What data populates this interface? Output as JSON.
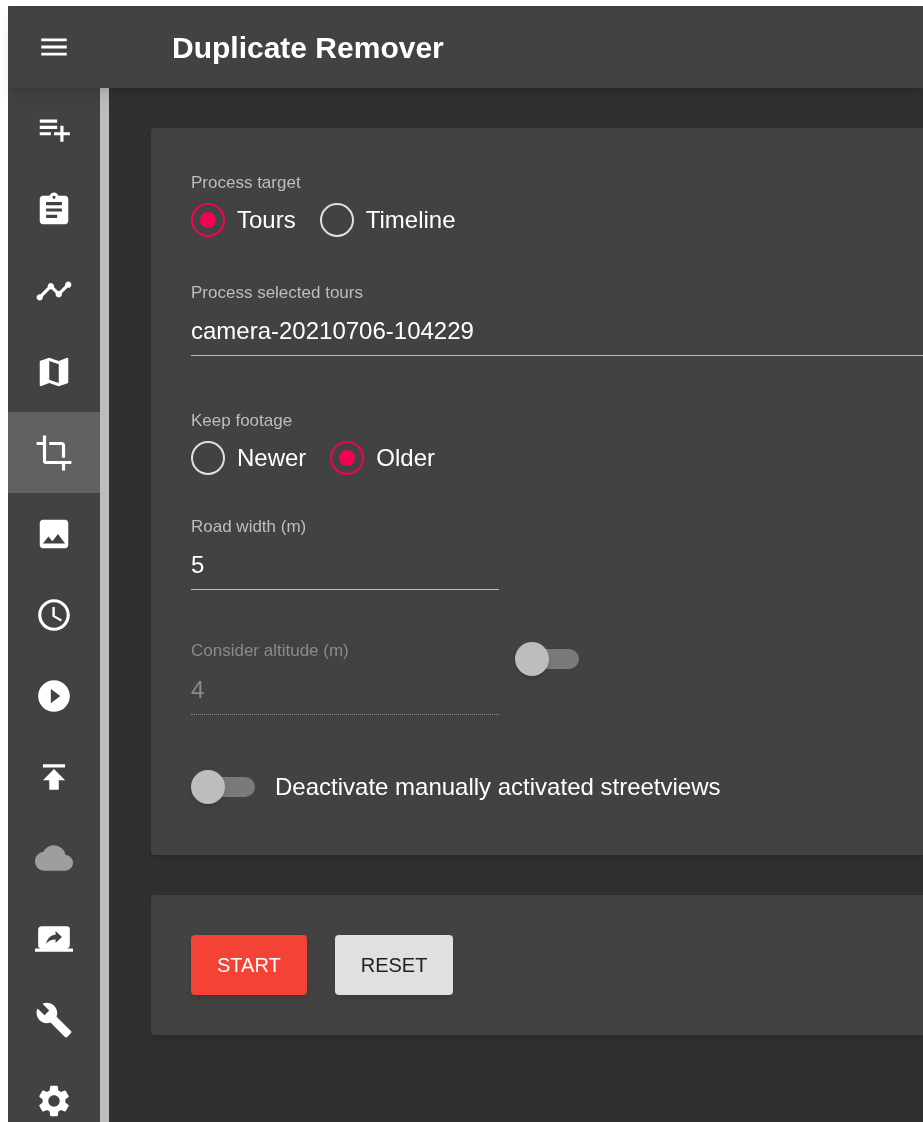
{
  "app_bar": {
    "title": "Duplicate Remover"
  },
  "nav_items": [
    {
      "kind": "playlist-add",
      "selected": false,
      "disabled": false
    },
    {
      "kind": "clipboard",
      "selected": false,
      "disabled": false
    },
    {
      "kind": "timeline",
      "selected": false,
      "disabled": false
    },
    {
      "kind": "map",
      "selected": false,
      "disabled": false
    },
    {
      "kind": "crop",
      "selected": true,
      "disabled": false
    },
    {
      "kind": "image",
      "selected": false,
      "disabled": false
    },
    {
      "kind": "clock",
      "selected": false,
      "disabled": false
    },
    {
      "kind": "play",
      "selected": false,
      "disabled": false
    },
    {
      "kind": "upload",
      "selected": false,
      "disabled": false
    },
    {
      "kind": "cloud",
      "selected": false,
      "disabled": true
    },
    {
      "kind": "screen-share",
      "selected": false,
      "disabled": false
    },
    {
      "kind": "wrench",
      "selected": false,
      "disabled": false
    },
    {
      "kind": "settings",
      "selected": false,
      "disabled": false
    }
  ],
  "form": {
    "process_target": {
      "label": "Process target",
      "options": [
        {
          "label": "Tours",
          "selected": true
        },
        {
          "label": "Timeline",
          "selected": false
        }
      ]
    },
    "selected_tours": {
      "label": "Process selected tours",
      "value": "camera-20210706-104229"
    },
    "keep_footage": {
      "label": "Keep footage",
      "options": [
        {
          "label": "Newer",
          "selected": false
        },
        {
          "label": "Older",
          "selected": true
        }
      ]
    },
    "road_width": {
      "label": "Road width (m)",
      "value": "5"
    },
    "consider_altitude": {
      "label": "Consider altitude (m)",
      "value": "4",
      "disabled": true,
      "on": false
    },
    "deactivate_streetviews": {
      "label": "Deactivate manually activated streetviews",
      "on": false
    }
  },
  "buttons": [
    {
      "label": "START",
      "kind": "primary"
    },
    {
      "label": "RESET",
      "kind": "secondary"
    }
  ]
}
